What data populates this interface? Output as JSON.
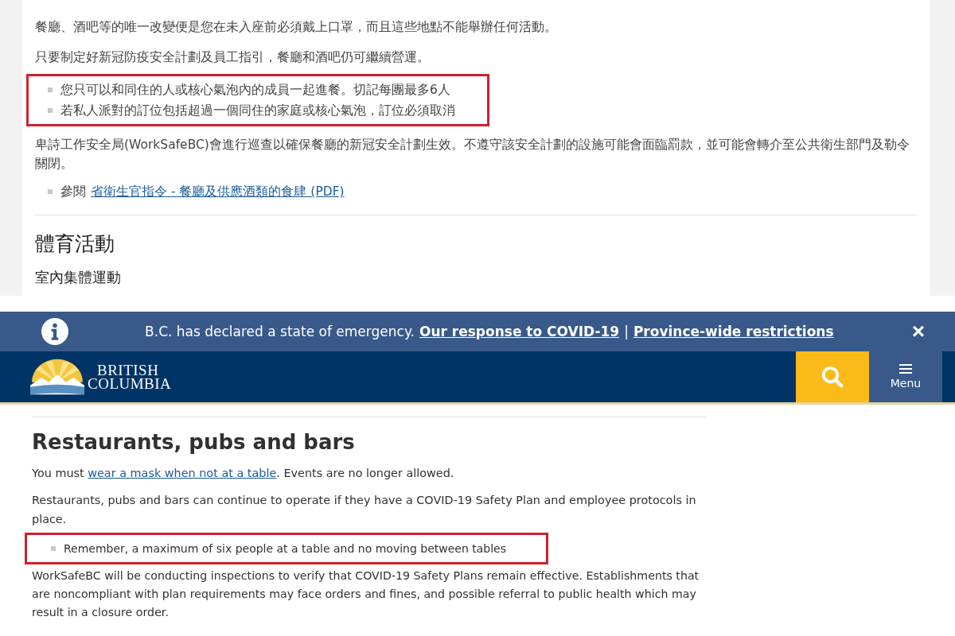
{
  "chinese_page": {
    "paragraphs": [
      "餐廳、酒吧等的唯一改變便是您在未入座前必須戴上口罩，而且這些地點不能舉辦任何活動。",
      "只要制定好新冠防疫安全計劃及員工指引，餐廳和酒吧仍可繼續營運。"
    ],
    "bullets": {
      "highlighted": true,
      "items": [
        "您只可以和同住的人或核心氣泡內的成員一起進餐。切記每團最多6人",
        "若私人派對的訂位包括超過一個同住的家庭或核心氣泡，訂位必須取消"
      ]
    },
    "paragraph_after": "卑詩工作安全局(WorkSafeBC)會進行巡查以確保餐廳的新冠安全計劃生效。不遵守該安全計劃的設施可能會面臨罰款，並可能會轉介至公共衛生部門及勒令關閉。",
    "see_also": {
      "prefix": "參閱",
      "link": "省衛生官指令 - 餐廳及供應酒類的食肆 (PDF)"
    },
    "heading": "體育活動",
    "subheading": "室內集體運動"
  },
  "alert_banner": {
    "text": "B.C. has declared a state of emergency.",
    "links": [
      "Our response to COVID-19",
      "Province-wide restrictions"
    ],
    "separator": "|",
    "close": "×"
  },
  "header": {
    "logo_lines": [
      "BRITISH",
      "COLUMBIA"
    ],
    "menu_label": "Menu"
  },
  "english_page": {
    "heading": "Restaurants, pubs and bars",
    "intro": {
      "before": "You must",
      "link": "wear a mask when not at a table",
      "after": ". Events are no longer allowed."
    },
    "paragraph": "Restaurants, pubs and bars can continue to operate if they have a COVID-19 Safety Plan and employee protocols in place.",
    "bullets": {
      "highlighted": true,
      "items": [
        "Remember, a maximum of six people at a table and no moving between tables"
      ]
    },
    "paragraph_after": "WorkSafeBC will be conducting inspections to verify that COVID-19 Safety Plans remain effective. Establishments that are noncompliant with plan requirements may face orders and fines, and possible referral to public health which may result in a closure order."
  }
}
